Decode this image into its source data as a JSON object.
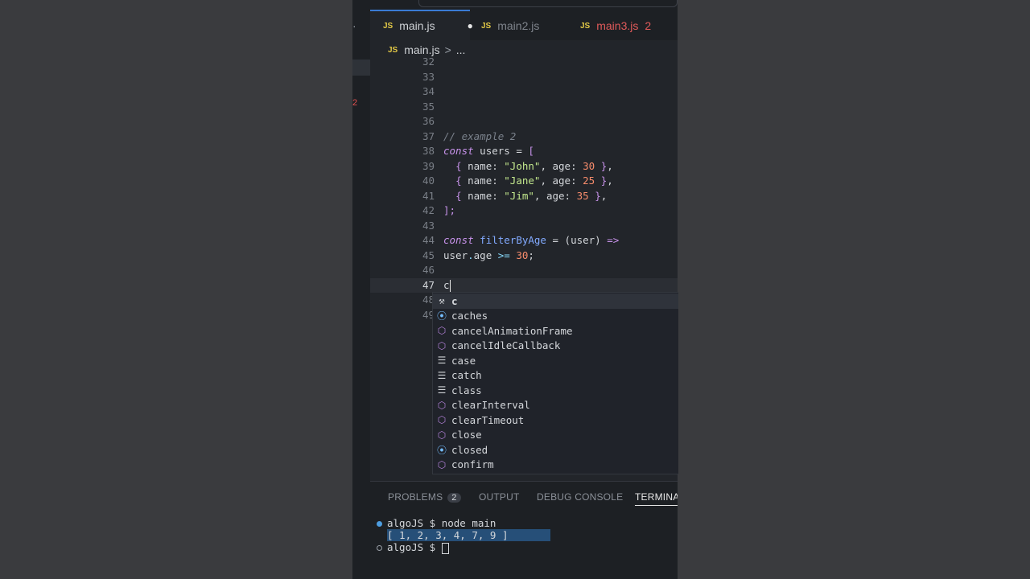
{
  "tabs": [
    {
      "icon": "JS",
      "label": "main.js",
      "state": "active",
      "modified": "●"
    },
    {
      "icon": "JS",
      "label": "main2.js",
      "state": "inactive"
    },
    {
      "icon": "JS",
      "label": "main3.js",
      "state": "error",
      "count": "2"
    }
  ],
  "breadcrumb": {
    "icon": "JS",
    "file": "main.js",
    "sep": ">",
    "more": "..."
  },
  "activity": {
    "badge": "2"
  },
  "gutter": [
    "32",
    "33",
    "34",
    "35",
    "36",
    "37",
    "38",
    "39",
    "40",
    "41",
    "42",
    "43",
    "44",
    "45",
    "46",
    "47",
    "48",
    "49"
  ],
  "code": {
    "l37": "// example 2",
    "l38_kw": "const",
    "l38_rest": " users = ",
    "l38_br": "[",
    "rows": [
      {
        "name": "\"John\"",
        "age": "30"
      },
      {
        "name": "\"Jane\"",
        "age": "25"
      },
      {
        "name": "\"Jim\"",
        "age": "35"
      }
    ],
    "l42": "];",
    "l44_kw": "const",
    "l44_fn": "filterByAge",
    "l44_rest": " = (user) ",
    "l44_arrow": "=>",
    "l45_a": "user",
    "l45_b": ".",
    "l45_c": "age",
    "l45_op": " >= ",
    "l45_num": "30",
    "l45_end": ";",
    "l47": "c"
  },
  "suggestions": [
    {
      "label": "c",
      "kind": "wrench-icon"
    },
    {
      "label": "caches",
      "kind": "variable-icon"
    },
    {
      "label": "cancelAnimationFrame",
      "kind": "method-icon"
    },
    {
      "label": "cancelIdleCallback",
      "kind": "method-icon"
    },
    {
      "label": "case",
      "kind": "keyword-icon"
    },
    {
      "label": "catch",
      "kind": "keyword-icon"
    },
    {
      "label": "class",
      "kind": "keyword-icon"
    },
    {
      "label": "clearInterval",
      "kind": "method-icon"
    },
    {
      "label": "clearTimeout",
      "kind": "method-icon"
    },
    {
      "label": "close",
      "kind": "method-icon"
    },
    {
      "label": "closed",
      "kind": "variable-icon"
    },
    {
      "label": "confirm",
      "kind": "method-icon"
    }
  ],
  "panel": {
    "tabs": [
      {
        "label": "PROBLEMS",
        "badge": "2"
      },
      {
        "label": "OUTPUT"
      },
      {
        "label": "DEBUG CONSOLE"
      },
      {
        "label": "TERMINAL"
      }
    ],
    "terminal": {
      "line1": "algoJS $ node main",
      "line2": "[ 1, 2, 3, 4, 7, 9 ]",
      "line3": "algoJS $ "
    }
  },
  "colors": {
    "accent": "#3a7bd5",
    "error": "#e05a5a",
    "keyword": "#c792ea",
    "string": "#c3e88d",
    "number": "#f78c6c"
  }
}
